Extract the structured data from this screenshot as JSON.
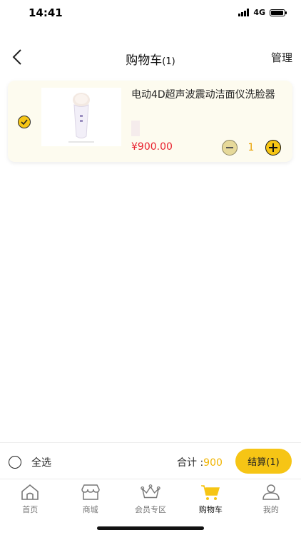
{
  "status_bar": {
    "time": "14:41",
    "network": "4G"
  },
  "nav": {
    "title": "购物车",
    "count": "(1)",
    "manage_label": "管理"
  },
  "cart": {
    "items": [
      {
        "name": "电动4D超声波震动洁面仪洗脸器",
        "price": "¥900.00",
        "quantity": "1",
        "checked": true
      }
    ]
  },
  "footer": {
    "select_all_label": "全选",
    "total_label": "合计 :",
    "total_value": "900",
    "checkout_label": "结算(1)"
  },
  "tabbar": {
    "tabs": [
      {
        "label": "首页",
        "icon": "home-icon"
      },
      {
        "label": "商城",
        "icon": "store-icon"
      },
      {
        "label": "会员专区",
        "icon": "crown-icon"
      },
      {
        "label": "购物车",
        "icon": "cart-icon",
        "active": true
      },
      {
        "label": "我的",
        "icon": "user-icon"
      }
    ]
  },
  "colors": {
    "accent": "#f6c515",
    "price": "#e8202d",
    "card_bg": "#fdfbef"
  }
}
